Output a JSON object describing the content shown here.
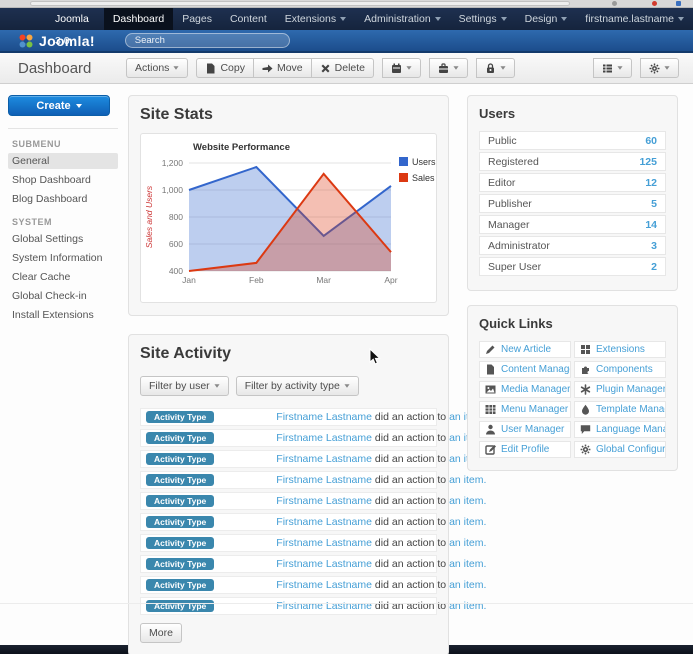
{
  "topnav": {
    "brand": "Joomla 3.0",
    "items": [
      {
        "label": "Dashboard",
        "active": true
      },
      {
        "label": "Pages"
      },
      {
        "label": "Content"
      },
      {
        "label": "Extensions",
        "dropdown": true
      }
    ],
    "right_items": [
      {
        "label": "Administration"
      },
      {
        "label": "Settings"
      },
      {
        "label": "Design"
      },
      {
        "label": "firstname.lastname"
      }
    ]
  },
  "masthead": {
    "logo_text": "Joomla!",
    "search_placeholder": "Search"
  },
  "toolbar": {
    "page_title": "Dashboard",
    "actions_label": "Actions",
    "copy_label": "Copy",
    "move_label": "Move",
    "delete_label": "Delete",
    "icon_dropdowns": [
      "calendar-icon",
      "briefcase-icon",
      "lock-icon"
    ],
    "right_buttons": [
      "grid-icon",
      "gear-icon"
    ]
  },
  "sidebar": {
    "create_label": "Create",
    "sections": [
      {
        "heading": "SUBMENU",
        "items": [
          {
            "label": "General",
            "active": true
          },
          {
            "label": "Shop Dashboard"
          },
          {
            "label": "Blog Dashboard"
          }
        ]
      },
      {
        "heading": "SYSTEM",
        "items": [
          {
            "label": "Global Settings"
          },
          {
            "label": "System Information"
          },
          {
            "label": "Clear Cache"
          },
          {
            "label": "Global Check-in"
          },
          {
            "label": "Install Extensions"
          }
        ]
      }
    ]
  },
  "site_stats": {
    "title": "Site Stats"
  },
  "chart_data": {
    "type": "area",
    "title": "Website Performance",
    "x": [
      "Jan",
      "Feb",
      "Mar",
      "Apr"
    ],
    "series": [
      {
        "name": "Users",
        "color": "#3366cc",
        "values": [
          1000,
          1170,
          660,
          1030
        ]
      },
      {
        "name": "Sales",
        "color": "#dc3912",
        "values": [
          400,
          460,
          1120,
          540
        ]
      }
    ],
    "ylabel": "Sales and Users",
    "xlabel": "",
    "ylim": [
      400,
      1200
    ],
    "ytick_values": [
      400,
      600,
      800,
      1000,
      1200
    ],
    "ytick_labels": [
      "400",
      "600",
      "800",
      "1,000",
      "1,200"
    ],
    "grid": true,
    "legend_position": "right"
  },
  "site_activity": {
    "title": "Site Activity",
    "filters": [
      {
        "label": "Filter by user"
      },
      {
        "label": "Filter by activity type"
      }
    ],
    "badge_label": "Activity Type",
    "row_user": "Firstname Lastname",
    "row_action": "did an action to",
    "row_item": "an item.",
    "row_count": 10,
    "more_label": "More"
  },
  "users_panel": {
    "title": "Users",
    "rows": [
      {
        "label": "Public",
        "count": "60"
      },
      {
        "label": "Registered",
        "count": "125"
      },
      {
        "label": "Editor",
        "count": "12"
      },
      {
        "label": "Publisher",
        "count": "5"
      },
      {
        "label": "Manager",
        "count": "14"
      },
      {
        "label": "Administrator",
        "count": "3"
      },
      {
        "label": "Super User",
        "count": "2"
      }
    ]
  },
  "quick_links": {
    "title": "Quick Links",
    "items": [
      {
        "label": "New Article",
        "icon": "pencil-icon"
      },
      {
        "label": "Extensions",
        "icon": "grid-icon"
      },
      {
        "label": "Content Manager",
        "icon": "file-icon"
      },
      {
        "label": "Components",
        "icon": "puzzle-icon"
      },
      {
        "label": "Media Manager",
        "icon": "image-icon"
      },
      {
        "label": "Plugin Manager",
        "icon": "asterisk-icon"
      },
      {
        "label": "Menu Manager",
        "icon": "table-icon"
      },
      {
        "label": "Template Manager",
        "icon": "droplet-icon"
      },
      {
        "label": "User Manager",
        "icon": "user-icon"
      },
      {
        "label": "Language Manager",
        "icon": "comment-icon"
      },
      {
        "label": "Edit Profile",
        "icon": "edit-icon"
      },
      {
        "label": "Global Configuration",
        "icon": "gear-icon"
      }
    ]
  },
  "colors": {
    "link_blue": "#459fd6",
    "badge_blue": "#3a87ad",
    "nav_bg": "#17263f",
    "masthead_blue": "#24599c",
    "primary_button_blue": "#1472c4",
    "users_series": "#3366cc",
    "sales_series": "#dc3912"
  }
}
